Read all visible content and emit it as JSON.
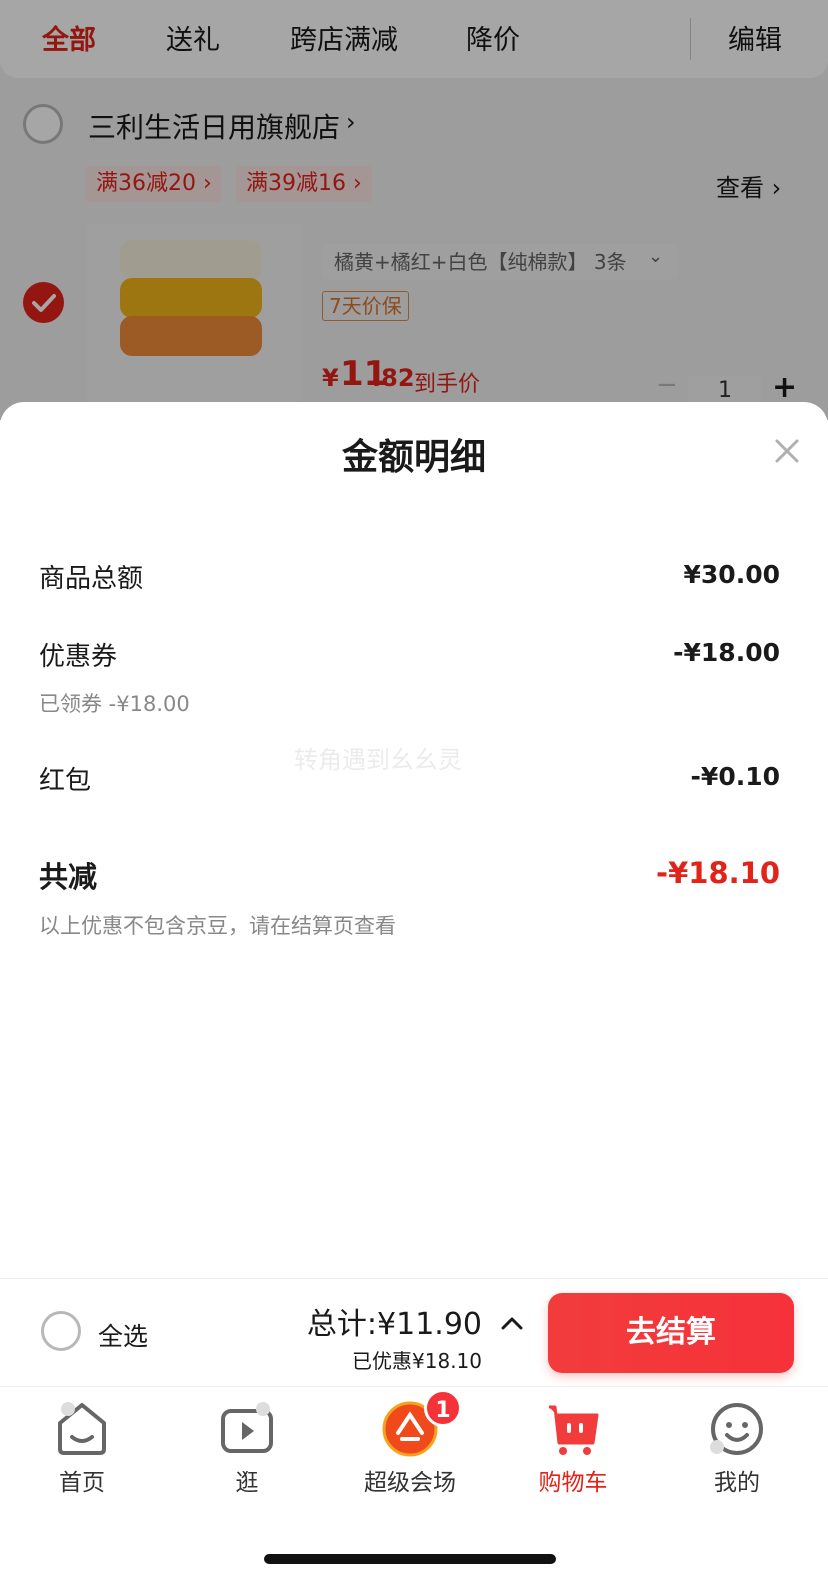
{
  "top_tabs": [
    "全部",
    "送礼",
    "跨店满减",
    "降价"
  ],
  "edit_label": "编辑",
  "store": {
    "name": "三利生活日用旗舰店",
    "arrow": "›"
  },
  "promos": [
    "满36减20 ›",
    "满39减16 ›"
  ],
  "view_more": "查看 ›",
  "item": {
    "spec": "橘黄+橘红+白色【纯棉款】 3条",
    "spec_arrow": "⌄",
    "guarantee": "7天价保",
    "price_symbol": "¥",
    "price_int": "11",
    "price_dec": ".82",
    "price_note": "到手价",
    "quantity": "1",
    "plus": "+",
    "minus": "−"
  },
  "sheet": {
    "title": "金额明细",
    "rows": {
      "goods_total_label": "商品总额",
      "goods_total_value": "¥30.00",
      "coupon_label": "优惠券",
      "coupon_value": "-¥18.00",
      "coupon_note": "已领券 -¥18.00",
      "redpack_label": "红包",
      "redpack_value": "-¥0.10",
      "saved_label": "共减",
      "saved_value": "-¥18.10"
    },
    "note": "以上优惠不包含京豆，请在结算页查看",
    "watermark": "转角遇到幺幺灵"
  },
  "checkout": {
    "select_all": "全选",
    "total": "总计:¥11.90",
    "saved": "已优惠¥18.10",
    "button": "去结算"
  },
  "tabbar": {
    "items": [
      "首页",
      "逛",
      "超级会场",
      "购物车",
      "我的"
    ],
    "badge": "1"
  },
  "colors": {
    "accent": "#e2231a",
    "button": "#f5323a"
  }
}
